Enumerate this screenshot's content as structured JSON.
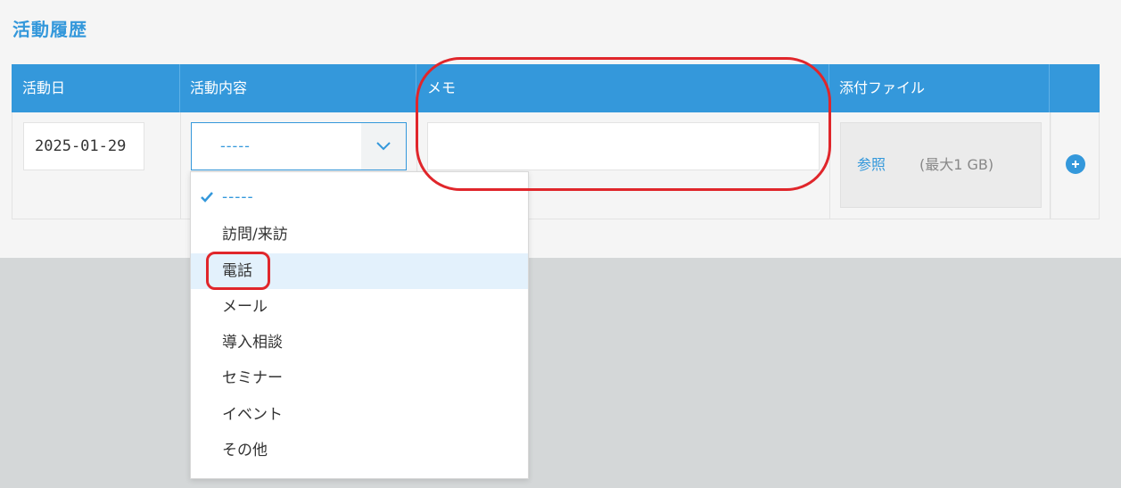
{
  "section": {
    "title": "活動履歴"
  },
  "table": {
    "headers": [
      "活動日",
      "活動内容",
      "メモ",
      "添付ファイル"
    ],
    "row": {
      "date": "2025-01-29",
      "activity_selected": "-----",
      "memo": "",
      "file": {
        "browse_label": "参照",
        "max_size": "(最大1 GB)"
      }
    }
  },
  "dropdown": {
    "options": [
      "-----",
      "訪問/来訪",
      "電話",
      "メール",
      "導入相談",
      "セミナー",
      "イベント",
      "その他"
    ],
    "selected_index": 0,
    "highlighted_index": 2
  },
  "colors": {
    "accent": "#3498db",
    "header_bg": "#3498db",
    "highlight_bg": "#e3f1fc",
    "annotation": "#e0262b",
    "page_bg": "#d4d7d8"
  },
  "icons": [
    "check-icon",
    "chevron-down-icon",
    "plus-circle-icon"
  ]
}
